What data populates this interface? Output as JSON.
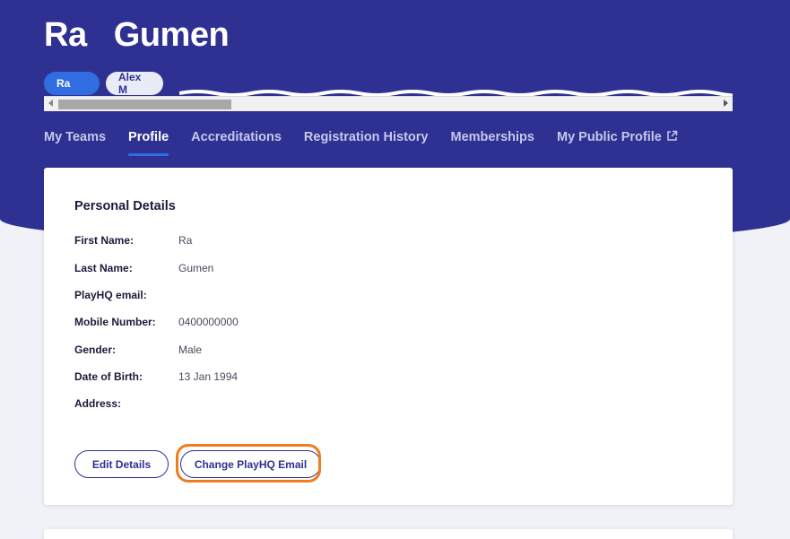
{
  "header": {
    "first_name": "Ra",
    "last_name": "Gumen",
    "chips": [
      {
        "label": "Ra",
        "active": true
      },
      {
        "label": "Alex M",
        "active": false
      }
    ]
  },
  "nav": {
    "tabs": [
      {
        "label": "My Teams",
        "active": false
      },
      {
        "label": "Profile",
        "active": true
      },
      {
        "label": "Accreditations",
        "active": false
      },
      {
        "label": "Registration History",
        "active": false
      },
      {
        "label": "Memberships",
        "active": false
      },
      {
        "label": "My Public Profile",
        "active": false,
        "icon": "external-link-icon"
      }
    ]
  },
  "personal_details": {
    "title": "Personal Details",
    "rows": [
      {
        "label": "First Name:",
        "value": "Ra"
      },
      {
        "label": "Last Name:",
        "value": "Gumen"
      },
      {
        "label": "PlayHQ email:",
        "value": ""
      },
      {
        "label": "Mobile Number:",
        "value": "0400000000"
      },
      {
        "label": "Gender:",
        "value": "Male"
      },
      {
        "label": "Date of Birth:",
        "value": "13 Jan 1994"
      },
      {
        "label": "Address:",
        "value": ""
      }
    ],
    "edit_label": "Edit Details",
    "change_email_label": "Change PlayHQ Email"
  },
  "colors": {
    "brand": "#2e3192",
    "accent": "#2f6de1",
    "highlight": "#f07c1e"
  }
}
